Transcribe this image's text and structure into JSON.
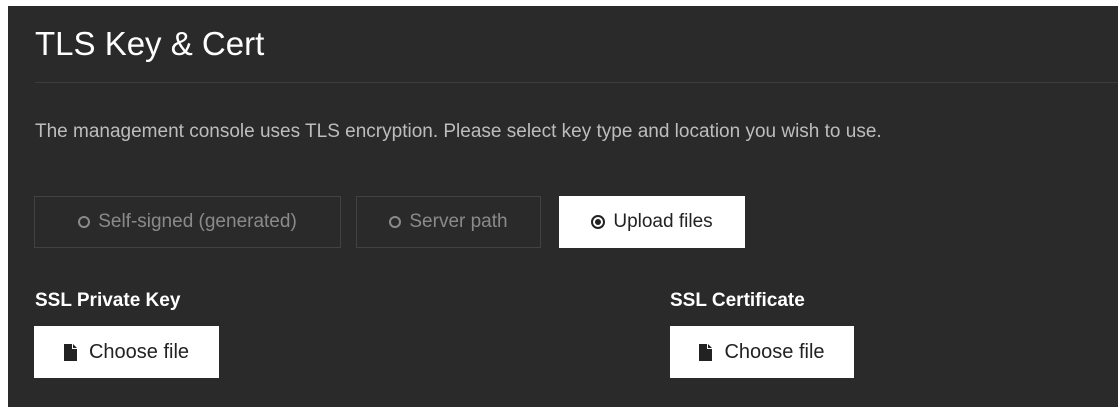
{
  "page": {
    "title": "TLS Key & Cert",
    "description": "The management console uses TLS encryption. Please select key type and location you wish to use."
  },
  "key_options": {
    "selected": "Upload files",
    "items": [
      {
        "label": "Self-signed (generated)",
        "selected": false
      },
      {
        "label": "Server path",
        "selected": false
      },
      {
        "label": "Upload files",
        "selected": true
      }
    ]
  },
  "private_key": {
    "label": "SSL Private Key",
    "button_label": "Choose file",
    "icon": "file-icon"
  },
  "certificate": {
    "label": "SSL Certificate",
    "button_label": "Choose file",
    "icon": "file-icon"
  },
  "colors": {
    "panel_background": "#2a2a2a",
    "text_primary": "#ffffff",
    "text_muted": "#bdbdbd",
    "option_inactive_text": "#8a8a8a",
    "button_background": "#ffffff"
  }
}
